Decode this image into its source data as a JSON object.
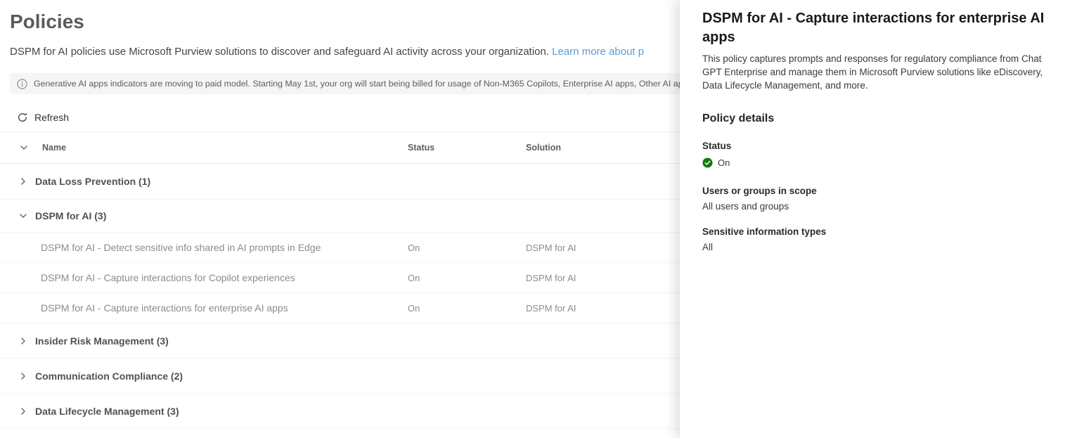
{
  "page": {
    "title": "Policies",
    "description": "DSPM for AI policies use Microsoft Purview solutions to discover and safeguard AI activity across your organization. ",
    "learn_more_link": "Learn more about p",
    "banner_text": "Generative AI apps indicators are moving to paid model. Starting May 1st,  your org will start being billed for usage of Non-M365 Copilots, Enterprise AI apps, Other AI apps.",
    "refresh_label": "Refresh"
  },
  "table": {
    "columns": [
      "Name",
      "Status",
      "Solution"
    ],
    "groups": [
      {
        "label": "Data Loss Prevention (1)",
        "expanded": false
      },
      {
        "label": "DSPM for AI (3)",
        "expanded": true,
        "children": [
          {
            "name": "DSPM for AI - Detect sensitive info shared in AI prompts in Edge",
            "status": "On",
            "solution": "DSPM for AI"
          },
          {
            "name": "DSPM for AI - Capture interactions for Copilot experiences",
            "status": "On",
            "solution": "DSPM for AI"
          },
          {
            "name": "DSPM for AI - Capture interactions for enterprise AI apps",
            "status": "On",
            "solution": "DSPM for AI"
          }
        ]
      },
      {
        "label": "Insider Risk Management (3)",
        "expanded": false
      },
      {
        "label": "Communication Compliance (2)",
        "expanded": false
      },
      {
        "label": "Data Lifecycle Management (3)",
        "expanded": false
      }
    ]
  },
  "panel": {
    "title": "DSPM for AI - Capture interactions for enterprise AI apps",
    "description": "This policy captures prompts and responses for regulatory compliance from Chat GPT Enterprise and manage them in Microsoft Purview solutions like eDiscovery, Data Lifecycle Management, and more.",
    "details_heading": "Policy details",
    "status_label": "Status",
    "status_value": "On",
    "users_label": "Users or groups in scope",
    "users_value": "All users and groups",
    "sensitive_label": "Sensitive information types",
    "sensitive_value": "All"
  },
  "colors": {
    "link_blue": "#5b9bd5",
    "status_on_green": "#107c10",
    "banner_background": "#f5f5f4"
  }
}
